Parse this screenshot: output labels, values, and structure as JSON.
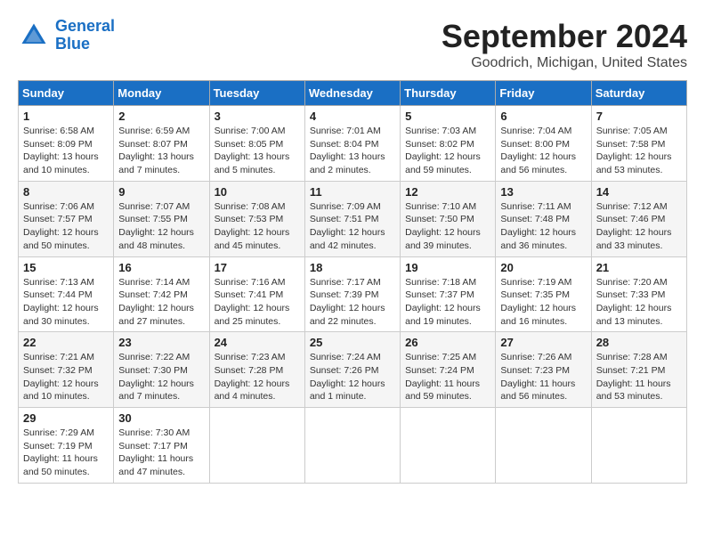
{
  "header": {
    "logo_line1": "General",
    "logo_line2": "Blue",
    "month_title": "September 2024",
    "location": "Goodrich, Michigan, United States"
  },
  "days_of_week": [
    "Sunday",
    "Monday",
    "Tuesday",
    "Wednesday",
    "Thursday",
    "Friday",
    "Saturday"
  ],
  "weeks": [
    [
      {
        "day": "1",
        "info": "Sunrise: 6:58 AM\nSunset: 8:09 PM\nDaylight: 13 hours\nand 10 minutes."
      },
      {
        "day": "2",
        "info": "Sunrise: 6:59 AM\nSunset: 8:07 PM\nDaylight: 13 hours\nand 7 minutes."
      },
      {
        "day": "3",
        "info": "Sunrise: 7:00 AM\nSunset: 8:05 PM\nDaylight: 13 hours\nand 5 minutes."
      },
      {
        "day": "4",
        "info": "Sunrise: 7:01 AM\nSunset: 8:04 PM\nDaylight: 13 hours\nand 2 minutes."
      },
      {
        "day": "5",
        "info": "Sunrise: 7:03 AM\nSunset: 8:02 PM\nDaylight: 12 hours\nand 59 minutes."
      },
      {
        "day": "6",
        "info": "Sunrise: 7:04 AM\nSunset: 8:00 PM\nDaylight: 12 hours\nand 56 minutes."
      },
      {
        "day": "7",
        "info": "Sunrise: 7:05 AM\nSunset: 7:58 PM\nDaylight: 12 hours\nand 53 minutes."
      }
    ],
    [
      {
        "day": "8",
        "info": "Sunrise: 7:06 AM\nSunset: 7:57 PM\nDaylight: 12 hours\nand 50 minutes."
      },
      {
        "day": "9",
        "info": "Sunrise: 7:07 AM\nSunset: 7:55 PM\nDaylight: 12 hours\nand 48 minutes."
      },
      {
        "day": "10",
        "info": "Sunrise: 7:08 AM\nSunset: 7:53 PM\nDaylight: 12 hours\nand 45 minutes."
      },
      {
        "day": "11",
        "info": "Sunrise: 7:09 AM\nSunset: 7:51 PM\nDaylight: 12 hours\nand 42 minutes."
      },
      {
        "day": "12",
        "info": "Sunrise: 7:10 AM\nSunset: 7:50 PM\nDaylight: 12 hours\nand 39 minutes."
      },
      {
        "day": "13",
        "info": "Sunrise: 7:11 AM\nSunset: 7:48 PM\nDaylight: 12 hours\nand 36 minutes."
      },
      {
        "day": "14",
        "info": "Sunrise: 7:12 AM\nSunset: 7:46 PM\nDaylight: 12 hours\nand 33 minutes."
      }
    ],
    [
      {
        "day": "15",
        "info": "Sunrise: 7:13 AM\nSunset: 7:44 PM\nDaylight: 12 hours\nand 30 minutes."
      },
      {
        "day": "16",
        "info": "Sunrise: 7:14 AM\nSunset: 7:42 PM\nDaylight: 12 hours\nand 27 minutes."
      },
      {
        "day": "17",
        "info": "Sunrise: 7:16 AM\nSunset: 7:41 PM\nDaylight: 12 hours\nand 25 minutes."
      },
      {
        "day": "18",
        "info": "Sunrise: 7:17 AM\nSunset: 7:39 PM\nDaylight: 12 hours\nand 22 minutes."
      },
      {
        "day": "19",
        "info": "Sunrise: 7:18 AM\nSunset: 7:37 PM\nDaylight: 12 hours\nand 19 minutes."
      },
      {
        "day": "20",
        "info": "Sunrise: 7:19 AM\nSunset: 7:35 PM\nDaylight: 12 hours\nand 16 minutes."
      },
      {
        "day": "21",
        "info": "Sunrise: 7:20 AM\nSunset: 7:33 PM\nDaylight: 12 hours\nand 13 minutes."
      }
    ],
    [
      {
        "day": "22",
        "info": "Sunrise: 7:21 AM\nSunset: 7:32 PM\nDaylight: 12 hours\nand 10 minutes."
      },
      {
        "day": "23",
        "info": "Sunrise: 7:22 AM\nSunset: 7:30 PM\nDaylight: 12 hours\nand 7 minutes."
      },
      {
        "day": "24",
        "info": "Sunrise: 7:23 AM\nSunset: 7:28 PM\nDaylight: 12 hours\nand 4 minutes."
      },
      {
        "day": "25",
        "info": "Sunrise: 7:24 AM\nSunset: 7:26 PM\nDaylight: 12 hours\nand 1 minute."
      },
      {
        "day": "26",
        "info": "Sunrise: 7:25 AM\nSunset: 7:24 PM\nDaylight: 11 hours\nand 59 minutes."
      },
      {
        "day": "27",
        "info": "Sunrise: 7:26 AM\nSunset: 7:23 PM\nDaylight: 11 hours\nand 56 minutes."
      },
      {
        "day": "28",
        "info": "Sunrise: 7:28 AM\nSunset: 7:21 PM\nDaylight: 11 hours\nand 53 minutes."
      }
    ],
    [
      {
        "day": "29",
        "info": "Sunrise: 7:29 AM\nSunset: 7:19 PM\nDaylight: 11 hours\nand 50 minutes."
      },
      {
        "day": "30",
        "info": "Sunrise: 7:30 AM\nSunset: 7:17 PM\nDaylight: 11 hours\nand 47 minutes."
      },
      null,
      null,
      null,
      null,
      null
    ]
  ]
}
